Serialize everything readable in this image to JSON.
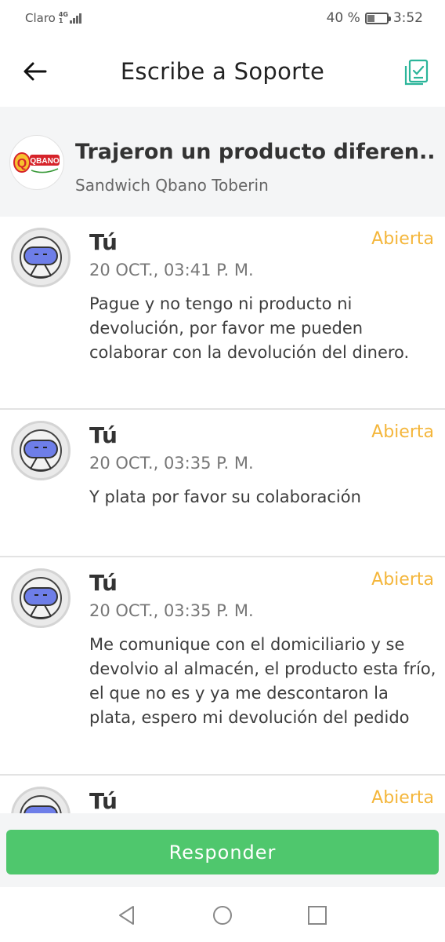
{
  "status_bar": {
    "carrier": "Claro",
    "network_top": "4G",
    "network_bottom": "1",
    "battery_text": "40 %",
    "battery_level": 0.4,
    "time": "3:52"
  },
  "header": {
    "title": "Escribe a Soporte",
    "back_icon": "arrow-left-icon",
    "action_icon": "checklist-icon"
  },
  "order": {
    "logo_text": "QBANO",
    "title": "Trajeron un producto diferen...",
    "store": "Sandwich Qbano Toberin"
  },
  "messages": [
    {
      "author": "Tú",
      "status": "Abierta",
      "time": "20 OCT., 03:41 P. M.",
      "text": "Pague y no tengo ni producto ni devolución, por favor me pueden colaborar con la devolución del dinero."
    },
    {
      "author": "Tú",
      "status": "Abierta",
      "time": "20 OCT., 03:35 P. M.",
      "text": "Y plata por favor su colaboración"
    },
    {
      "author": "Tú",
      "status": "Abierta",
      "time": "20 OCT., 03:35 P. M.",
      "text": "Me comunique con el domiciliario y se devolvio al almacén, el producto esta frío, el que no es y ya me descontaron la plata, espero mi devolución del pedido"
    },
    {
      "author": "Tú",
      "status": "Abierta",
      "time": "",
      "text": ""
    }
  ],
  "reply": {
    "label": "Responder"
  },
  "colors": {
    "accent_green": "#4fc76d",
    "status_yellow": "#f4b63b",
    "header_icon_teal": "#2bb59a"
  }
}
